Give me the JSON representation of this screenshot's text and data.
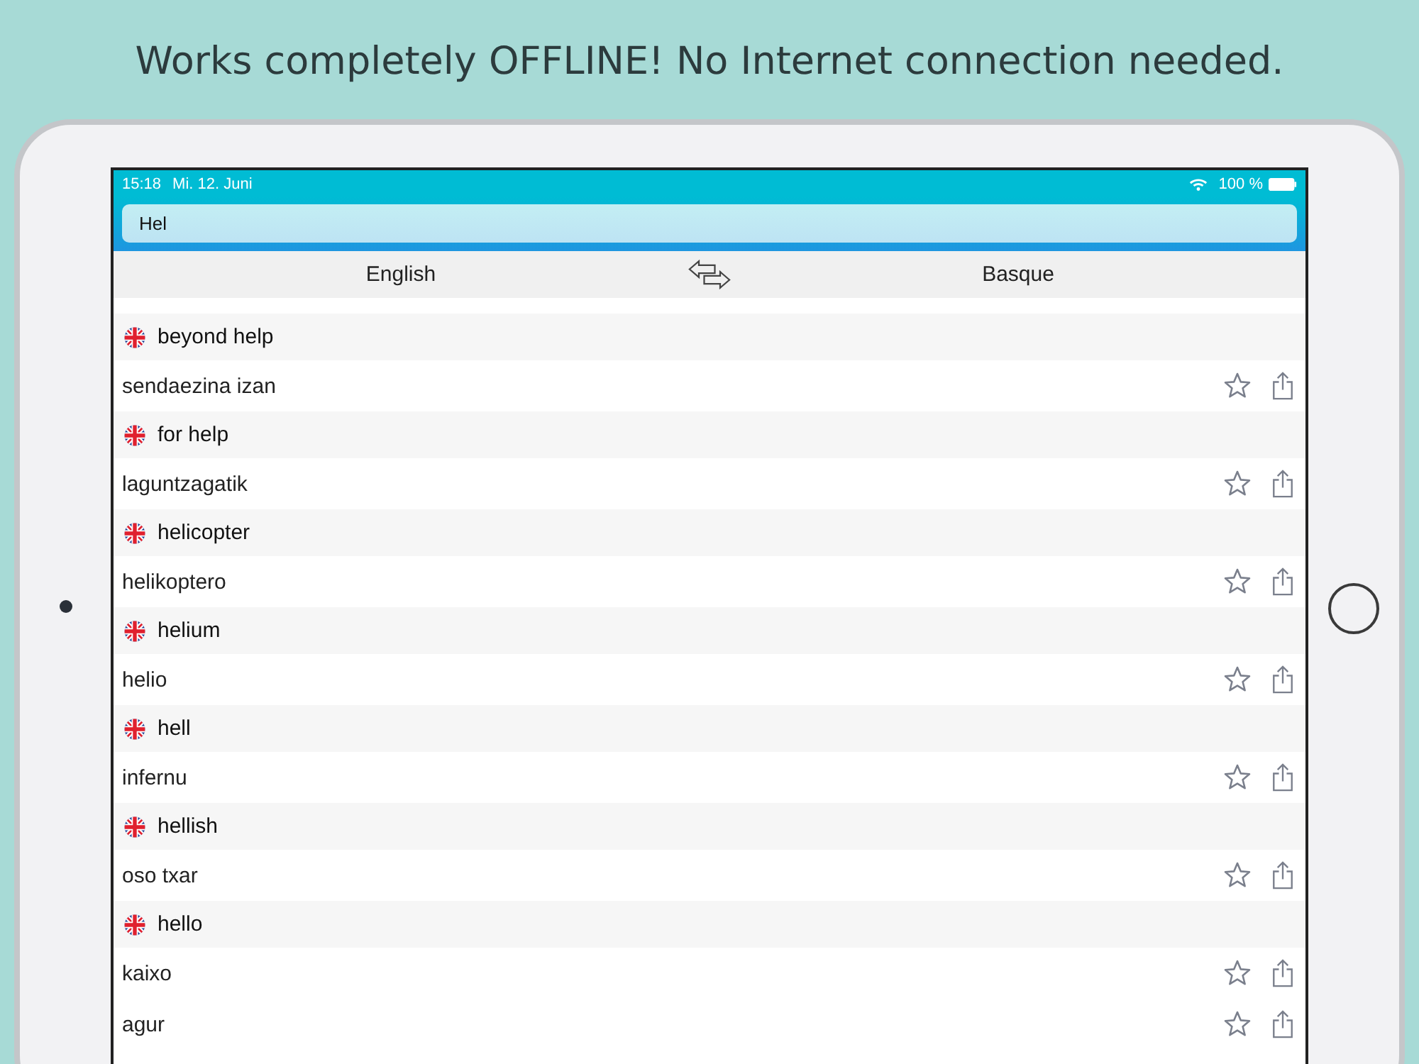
{
  "headline": "Works completely OFFLINE! No Internet connection needed.",
  "status_bar": {
    "time": "15:18",
    "date": "Mi. 12. Juni",
    "battery": "100 %"
  },
  "search": {
    "value": "Hel"
  },
  "languages": {
    "source": "English",
    "target": "Basque"
  },
  "entries": [
    {
      "term": "beyond help",
      "translations": [
        "sendaezina izan"
      ]
    },
    {
      "term": "for help",
      "translations": [
        "laguntzagatik"
      ]
    },
    {
      "term": "helicopter",
      "translations": [
        "helikoptero"
      ]
    },
    {
      "term": "helium",
      "translations": [
        "helio"
      ]
    },
    {
      "term": "hell",
      "translations": [
        "infernu"
      ]
    },
    {
      "term": "hellish",
      "translations": [
        "oso txar"
      ]
    },
    {
      "term": "hello",
      "translations": [
        "kaixo",
        "agur"
      ]
    }
  ]
}
